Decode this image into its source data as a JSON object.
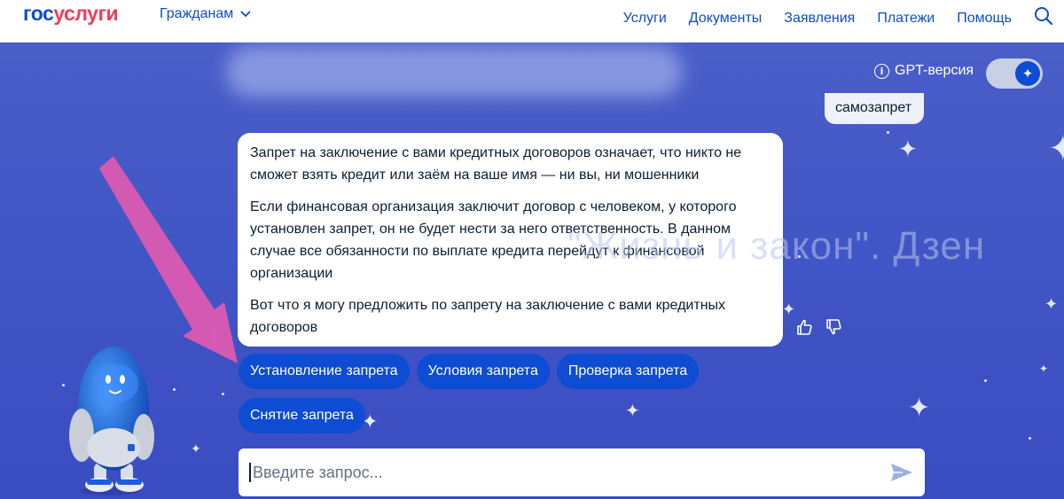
{
  "header": {
    "logo_part1": "гос",
    "logo_part2": "услуги",
    "citizens_label": "Гражданам",
    "nav": [
      "Услуги",
      "Документы",
      "Заявления",
      "Платежи",
      "Помощь"
    ]
  },
  "gpt": {
    "label": "GPT-версия",
    "enabled": true
  },
  "chat": {
    "user_message": "самозапрет",
    "bot_paragraphs": [
      "Запрет на заключение с вами кредитных договоров означает, что никто не сможет взять кредит или заём на ваше имя — ни вы, ни мошенники",
      "Если финансовая организация заключит договор с человеком, у которого установлен запрет, он не будет нести за него ответственность. В данном случае все обязанности по выплате кредита перейдут к финансовой организации",
      "Вот что я могу предложить по запрету на заключение с вами кредитных договоров"
    ],
    "suggestions": [
      "Установление запрета",
      "Условия запрета",
      "Проверка запрета",
      "Снятие запрета"
    ]
  },
  "input": {
    "placeholder": "Введите запрос..."
  },
  "watermark": "\"Жизнь и закон\". Дзен",
  "colors": {
    "brand_blue": "#0d4cd3",
    "brand_red": "#ee3f58",
    "background": "#4156c6",
    "annotation_arrow": "#e05ab0"
  }
}
